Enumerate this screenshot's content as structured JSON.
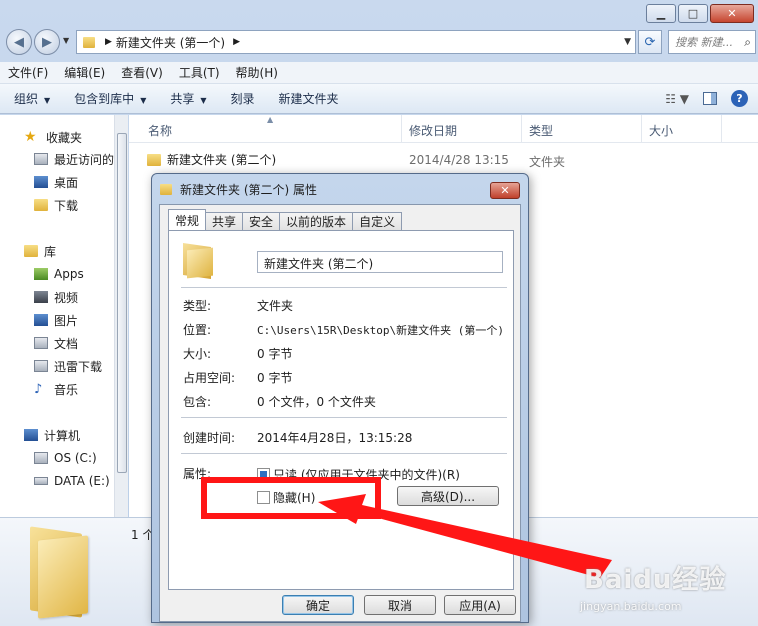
{
  "explorer": {
    "address_path": "新建文件夹 (第一个)",
    "search_placeholder": "搜索 新建...",
    "menu": [
      "文件(F)",
      "编辑(E)",
      "查看(V)",
      "工具(T)",
      "帮助(H)"
    ],
    "commands": {
      "organize": "组织",
      "include_library": "包含到库中",
      "share": "共享",
      "burn": "刻录",
      "new_folder": "新建文件夹"
    },
    "nav": {
      "favorites": "收藏夹",
      "recent": "最近访问的",
      "desktop": "桌面",
      "downloads": "下载",
      "libraries": "库",
      "apps": "Apps",
      "videos": "视频",
      "pictures": "图片",
      "documents": "文档",
      "xunlei": "迅雷下载",
      "music": "音乐",
      "computer": "计算机",
      "drive_c": "OS (C:)",
      "drive_e": "DATA (E:)"
    },
    "columns": {
      "name": "名称",
      "modified": "修改日期",
      "type": "类型",
      "size": "大小"
    },
    "file": {
      "name": "新建文件夹 (第二个)",
      "modified": "2014/4/28 13:15",
      "type": "文件夹"
    },
    "details_count": "1 个"
  },
  "dialog": {
    "title": "新建文件夹 (第二个) 属性",
    "tabs": [
      "常规",
      "共享",
      "安全",
      "以前的版本",
      "自定义"
    ],
    "folder_name": "新建文件夹 (第二个)",
    "labels": {
      "type": "类型:",
      "location": "位置:",
      "size": "大小:",
      "size_on_disk": "占用空间:",
      "contains": "包含:",
      "created": "创建时间:",
      "attributes": "属性:"
    },
    "values": {
      "type": "文件夹",
      "location": "C:\\Users\\15R\\Desktop\\新建文件夹 (第一个)",
      "size": "0 字节",
      "size_on_disk": "0 字节",
      "contains": "0 个文件，0 个文件夹",
      "created": "2014年4月28日，13:15:28"
    },
    "readonly_label": "只读 (仅应用于文件夹中的文件)(R)",
    "hidden_label": "隐藏(H)",
    "advanced_button": "高级(D)...",
    "ok_button": "确定",
    "cancel_button": "取消",
    "apply_button": "应用(A)"
  },
  "watermark": {
    "logo": "Baidu经验",
    "url": "jingyan.baidu.com"
  },
  "colors": {
    "annotation_red": "#ff1616",
    "accent_blue": "#2c63b7",
    "folder_yellow": "#e0b23c"
  }
}
